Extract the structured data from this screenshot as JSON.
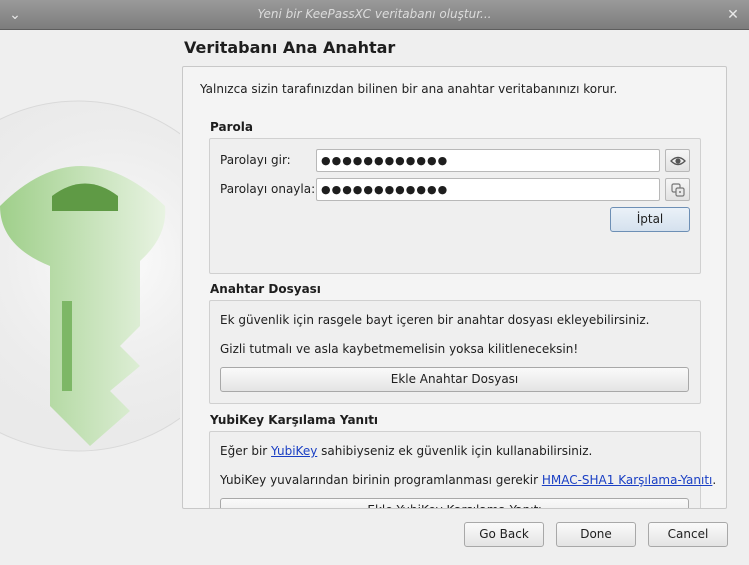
{
  "window": {
    "title": "Yeni bir KeePassXC veritabanı oluştur..."
  },
  "page": {
    "title": "Veritabanı Ana Anahtar",
    "intro": "Yalnızca sizin tarafınızdan bilinen bir ana anahtar veritabanınızı korur."
  },
  "password": {
    "section_title": "Parola",
    "enter_label": "Parolayı gir:",
    "enter_value": "●●●●●●●●●●●●",
    "confirm_label": "Parolayı onayla:",
    "confirm_value": "●●●●●●●●●●●●",
    "show_icon": "eye-icon",
    "generate_icon": "dice-icon",
    "cancel_label": "İptal"
  },
  "keyfile": {
    "section_title": "Anahtar Dosyası",
    "line1": "Ek güvenlik için rasgele bayt içeren bir anahtar dosyası ekleyebilirsiniz.",
    "line2": "Gizli tutmalı ve asla kaybetmemelisin yoksa kilitleneceksin!",
    "add_label": "Ekle Anahtar Dosyası"
  },
  "yubikey": {
    "section_title": "YubiKey Karşılama Yanıtı",
    "line1_pre": "Eğer bir ",
    "line1_link": "YubiKey",
    "line1_post": " sahibiyseniz ek güvenlik için kullanabilirsiniz.",
    "line2_pre": "YubiKey yuvalarından birinin programlanması gerekir ",
    "line2_link": "HMAC-SHA1 Karşılama-Yanıtı",
    "line2_post": ".",
    "add_label": "Ekle YubiKey Karşılama Yanıtı"
  },
  "footer": {
    "back_label": "Go Back",
    "done_label": "Done",
    "cancel_label": "Cancel"
  },
  "colors": {
    "logo_green": "#6aa74f",
    "link": "#1a3fc4",
    "primary_border": "#6d8fb5"
  }
}
